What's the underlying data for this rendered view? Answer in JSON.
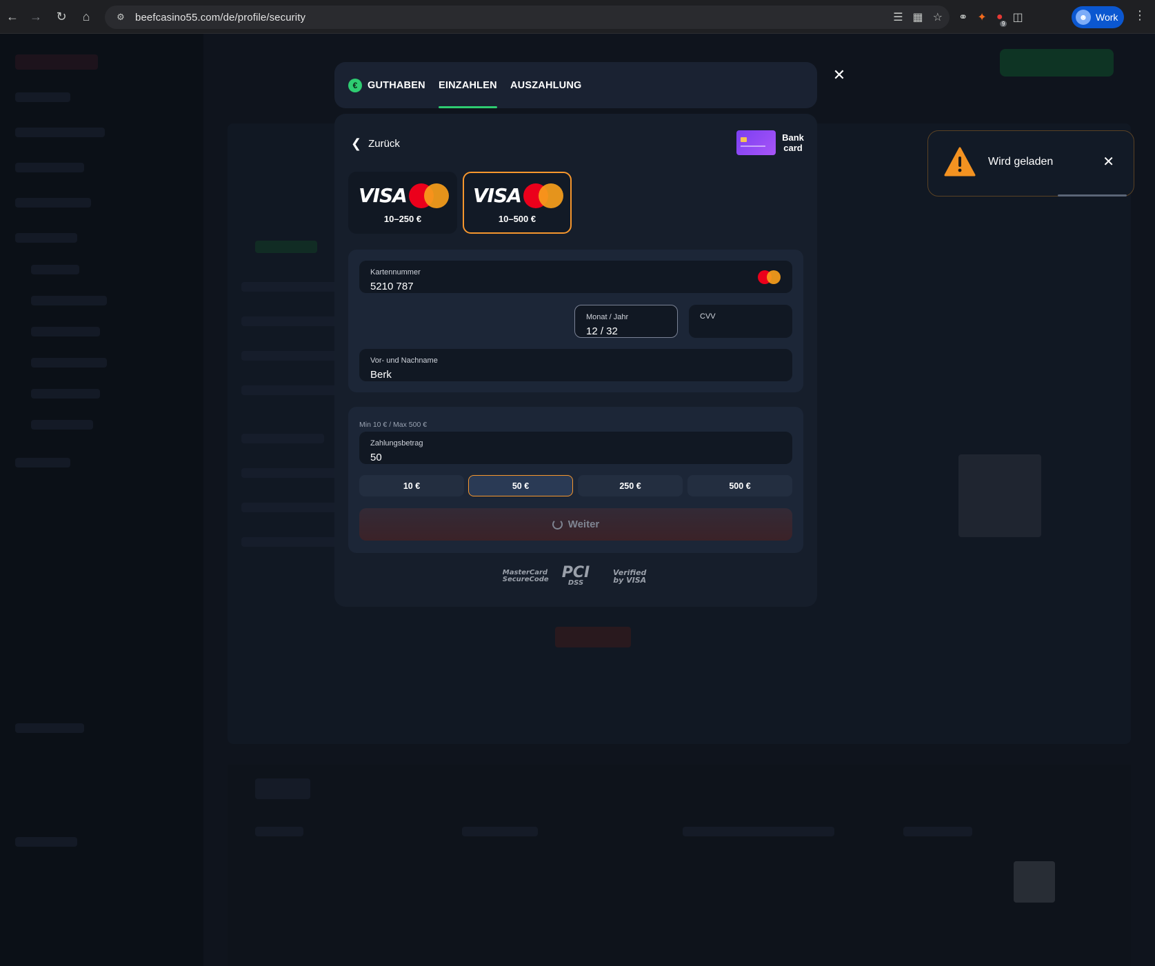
{
  "browser": {
    "url": "beefcasino55.com/de/profile/security",
    "profile_label": "Work",
    "extension_badge": "9"
  },
  "dialog": {
    "tabs": [
      {
        "label": "GUTHABEN"
      },
      {
        "label": "EINZAHLEN"
      },
      {
        "label": "AUSZAHLUNG"
      }
    ],
    "active_tab": "EINZAHLEN",
    "close_icon": "close-icon",
    "back_label": "Zurück",
    "bank_card_label": "Bank card",
    "methods": [
      {
        "brand": "VISA",
        "range": "10–250 €",
        "selected": false
      },
      {
        "brand": "VISA",
        "range": "10–500 €",
        "selected": true
      }
    ],
    "card_form": {
      "card_number_label": "Kartennummer",
      "card_number_value": "5210 787",
      "expiry_label": "Monat / Jahr",
      "expiry_value": "12 / 32",
      "cvv_label": "CVV",
      "cvv_value": "",
      "name_label": "Vor- und Nachname",
      "name_value": "Berk"
    },
    "amount": {
      "limits": "Min 10 € / Max 500 €",
      "label": "Zahlungsbetrag",
      "value": "50",
      "presets": [
        "10 €",
        "50 €",
        "250 €",
        "500 €"
      ],
      "selected_preset": "50 €",
      "submit_label": "Weiter"
    },
    "trust_logos": {
      "mastercard": "MasterCard SecureCode",
      "pci": "PCI",
      "pci_sub": "DSS",
      "visa_verified": "Verified by VISA"
    }
  },
  "toast": {
    "message": "Wird geladen",
    "icon": "warning-icon"
  },
  "colors": {
    "accent_green": "#2ecc71",
    "selected_orange": "#f7972d",
    "mastercard_red": "#eb001b",
    "mastercard_orange": "#f79e1b"
  }
}
